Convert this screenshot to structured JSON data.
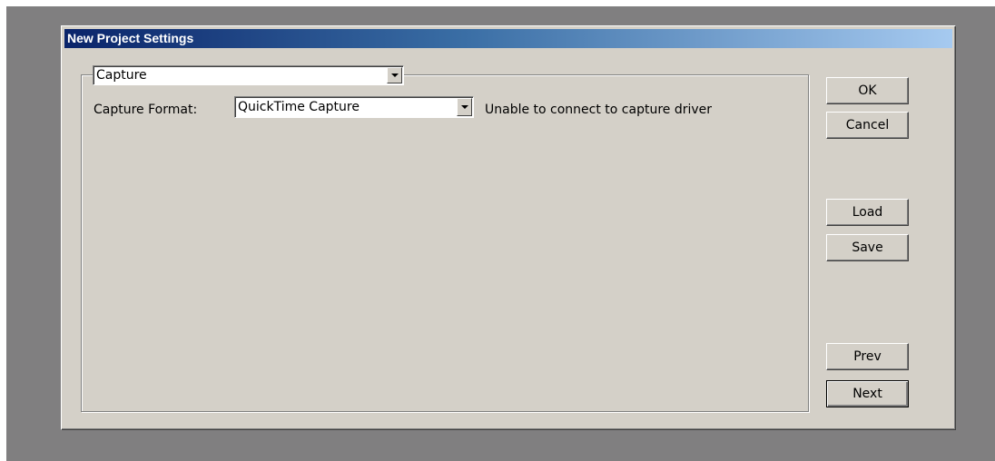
{
  "window": {
    "title": "New Project Settings"
  },
  "section_select": {
    "value": "Capture"
  },
  "capture": {
    "format_label": "Capture Format:",
    "format_value": "QuickTime Capture",
    "status_text": "Unable to connect to capture driver"
  },
  "buttons": {
    "ok": "OK",
    "cancel": "Cancel",
    "load": "Load",
    "save": "Save",
    "prev": "Prev",
    "next": "Next"
  },
  "colors": {
    "dialog_face": "#d4d0c8",
    "titlebar_start": "#0a246a",
    "titlebar_end": "#a6caf0",
    "desktop": "#807f80"
  }
}
